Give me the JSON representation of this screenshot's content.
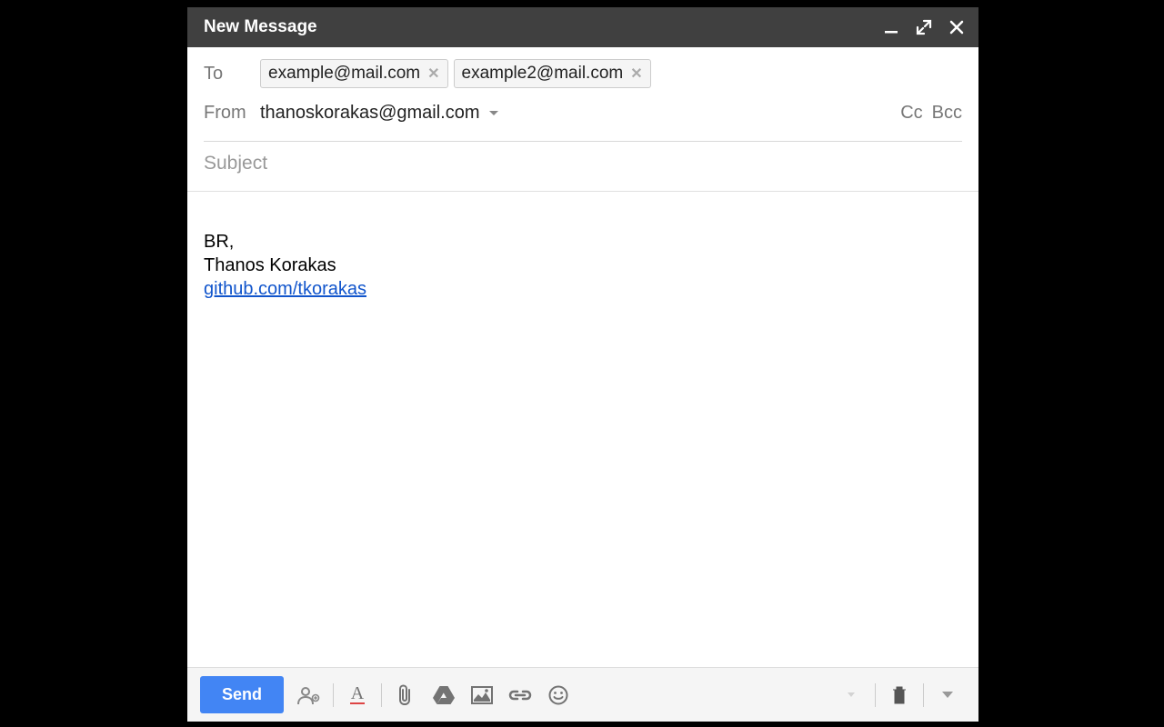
{
  "header": {
    "title": "New Message"
  },
  "to": {
    "label": "To",
    "chips": [
      "example@mail.com",
      "example2@mail.com"
    ]
  },
  "from": {
    "label": "From",
    "value": "thanoskorakas@gmail.com",
    "cc_label": "Cc",
    "bcc_label": "Bcc"
  },
  "subject": {
    "placeholder": "Subject",
    "value": ""
  },
  "body": {
    "line1": "BR,",
    "line2": "Thanos Korakas",
    "link_text": "github.com/tkorakas"
  },
  "toolbar": {
    "send_label": "Send"
  }
}
